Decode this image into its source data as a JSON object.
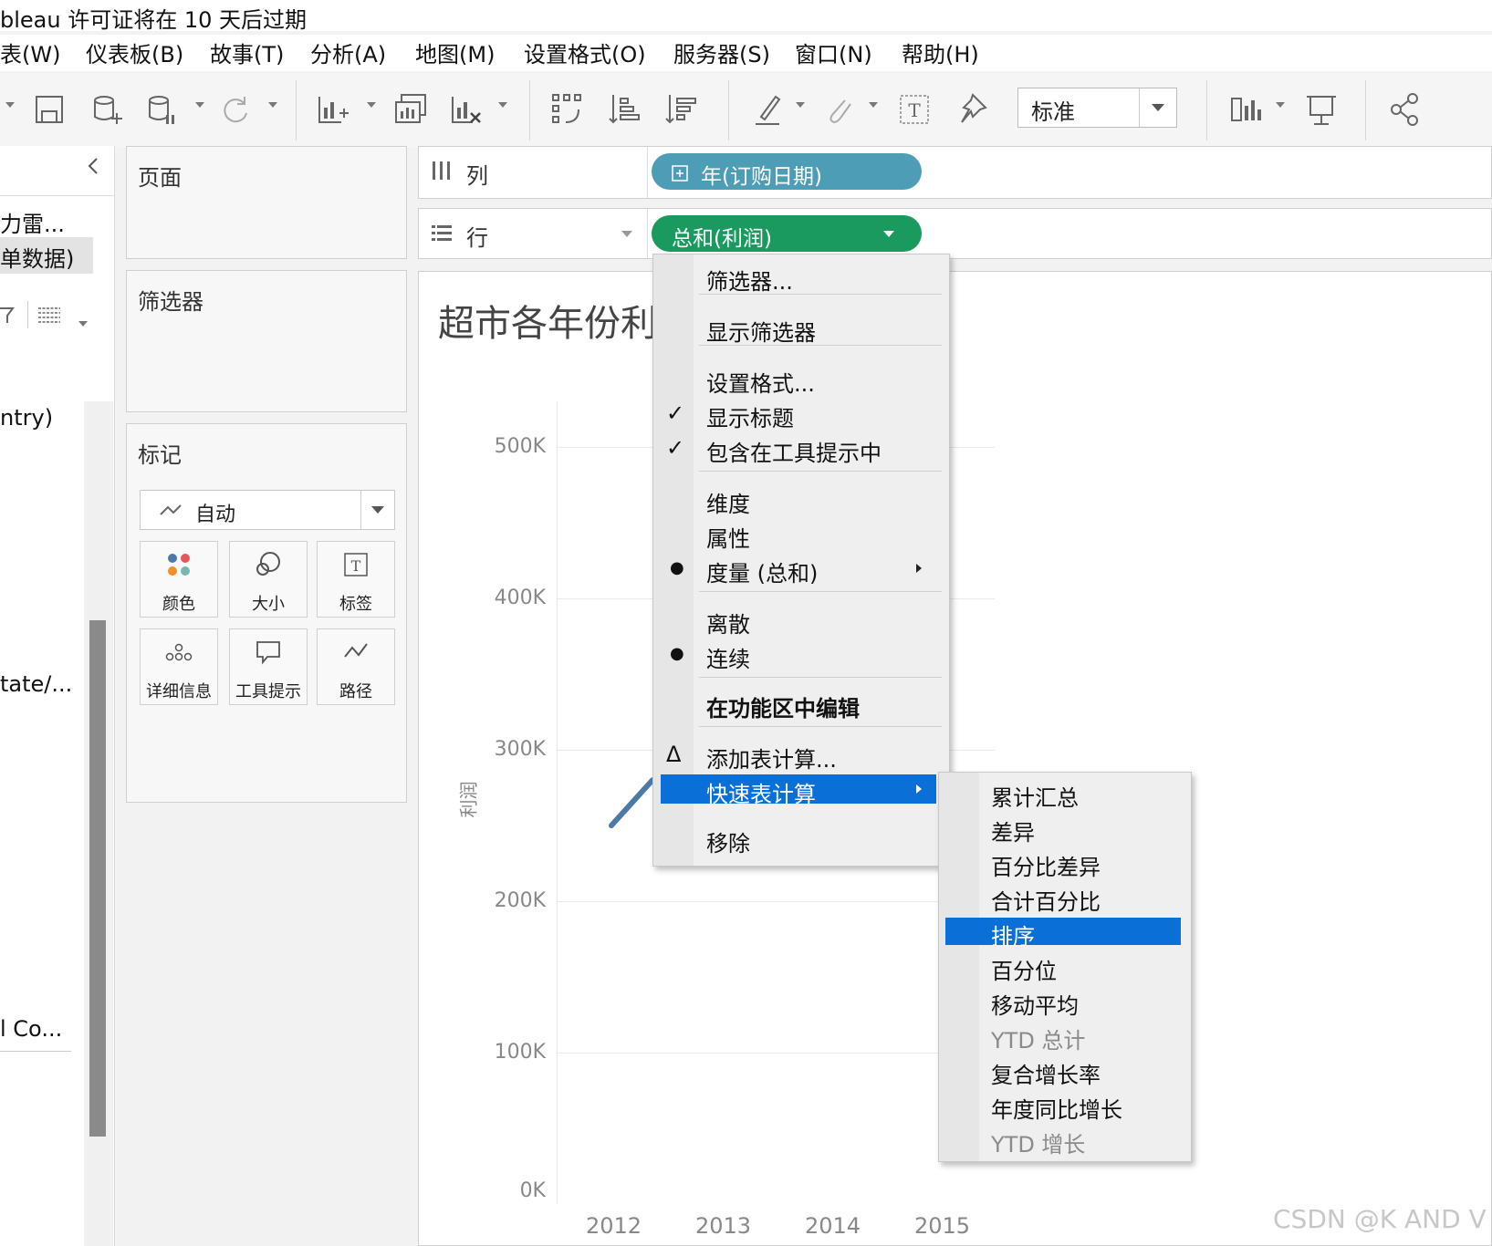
{
  "window": {
    "title": "bleau 许可证将在 10 天后过期"
  },
  "menubar": {
    "items": [
      "表(W)",
      "仪表板(B)",
      "故事(T)",
      "分析(A)",
      "地图(M)",
      "设置格式(O)",
      "服务器(S)",
      "窗口(N)",
      "帮助(H)"
    ]
  },
  "toolbar": {
    "view_size_select": "标准",
    "icons": [
      "save-icon",
      "new-datasource-icon",
      "datasource-pause-icon",
      "refresh-icon",
      "new-worksheet-icon",
      "duplicate-sheet-icon",
      "clear-sheet-icon",
      "swap-axes-icon",
      "sort-ascending-icon",
      "sort-descending-icon",
      "highlight-icon",
      "annotate-icon",
      "labels-icon",
      "pin-icon",
      "show-me-icon",
      "presentation-icon",
      "share-icon"
    ]
  },
  "data_pane": {
    "items": [
      "力雷...",
      "单数据)",
      "ntry)",
      "tate/...",
      "l Co..."
    ]
  },
  "cards": {
    "pages": "页面",
    "filters": "筛选器",
    "marks": "标记",
    "mark_type": "自动",
    "mark_buttons": [
      "颜色",
      "大小",
      "标签",
      "详细信息",
      "工具提示",
      "路径"
    ]
  },
  "shelves": {
    "columns_label": "列",
    "rows_label": "行",
    "columns_pill": "年(订购日期)",
    "rows_pill": "总和(利润)"
  },
  "colors": {
    "columns_pill": "#4e9db6",
    "rows_pill": "#1a9a5e",
    "highlight": "#0a6fd6",
    "line": "#4e79a7"
  },
  "chart": {
    "title": "超市各年份利",
    "ylabel": "利润",
    "yticks": [
      "500K",
      "400K",
      "300K",
      "200K",
      "100K",
      "0K"
    ],
    "xticks": [
      "2012",
      "2013",
      "2014",
      "2015"
    ]
  },
  "chart_data": {
    "type": "line",
    "title": "超市各年份利",
    "xlabel": "",
    "ylabel": "利润",
    "categories": [
      "2012",
      "2013",
      "2014",
      "2015"
    ],
    "ylim": [
      0,
      500000
    ],
    "visible_segment_values": [
      250000,
      280000
    ],
    "grid": true
  },
  "context_menu": {
    "items": [
      {
        "label": "筛选器..."
      },
      {
        "label": "显示筛选器"
      },
      {
        "label": "设置格式..."
      },
      {
        "label": "显示标题",
        "mark": "✓"
      },
      {
        "label": "包含在工具提示中",
        "mark": "✓"
      },
      {
        "label": "维度"
      },
      {
        "label": "属性"
      },
      {
        "label": "度量 (总和)",
        "mark": "●",
        "submenu": true
      },
      {
        "label": "离散"
      },
      {
        "label": "连续",
        "mark": "●"
      },
      {
        "label": "在功能区中编辑"
      },
      {
        "label": "添加表计算...",
        "mark": "Δ"
      },
      {
        "label": "快速表计算",
        "submenu": true,
        "highlighted": true
      },
      {
        "label": "移除"
      }
    ]
  },
  "submenu": {
    "items": [
      {
        "label": "累计汇总"
      },
      {
        "label": "差异"
      },
      {
        "label": "百分比差异"
      },
      {
        "label": "合计百分比"
      },
      {
        "label": "排序",
        "highlighted": true
      },
      {
        "label": "百分位"
      },
      {
        "label": "移动平均"
      },
      {
        "label": "YTD 总计",
        "disabled": true
      },
      {
        "label": "复合增长率"
      },
      {
        "label": "年度同比增长"
      },
      {
        "label": "YTD 增长",
        "disabled": true
      }
    ]
  },
  "watermark": "CSDN @K AND V"
}
